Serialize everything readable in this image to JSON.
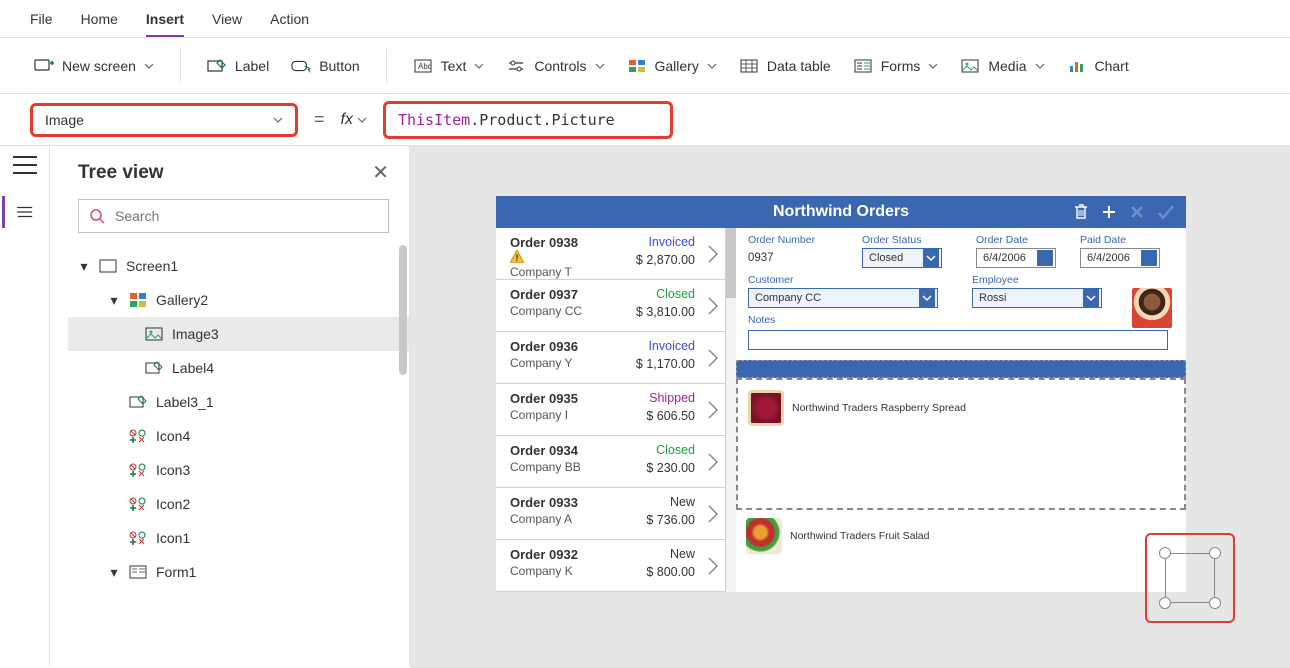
{
  "menu": {
    "file": "File",
    "home": "Home",
    "insert": "Insert",
    "view": "View",
    "action": "Action"
  },
  "ribbon": {
    "new_screen": "New screen",
    "label": "Label",
    "button": "Button",
    "text": "Text",
    "controls": "Controls",
    "gallery": "Gallery",
    "data_table": "Data table",
    "forms": "Forms",
    "media": "Media",
    "chart": "Chart"
  },
  "formula": {
    "property": "Image",
    "fx": "fx",
    "token_thisitem": "ThisItem",
    "token_rest": ".Product.Picture"
  },
  "tree": {
    "title": "Tree view",
    "search_placeholder": "Search",
    "nodes": {
      "screen1": "Screen1",
      "gallery2": "Gallery2",
      "image3": "Image3",
      "label4": "Label4",
      "label3_1": "Label3_1",
      "icon4": "Icon4",
      "icon3": "Icon3",
      "icon2": "Icon2",
      "icon1": "Icon1",
      "form1": "Form1"
    }
  },
  "app": {
    "title": "Northwind Orders",
    "orders": [
      {
        "num": "Order 0938",
        "company": "Company T",
        "status": "Invoiced",
        "status_cls": "st-invoiced",
        "amount": "$ 2,870.00",
        "warn": true
      },
      {
        "num": "Order 0937",
        "company": "Company CC",
        "status": "Closed",
        "status_cls": "st-closed",
        "amount": "$ 3,810.00",
        "warn": false
      },
      {
        "num": "Order 0936",
        "company": "Company Y",
        "status": "Invoiced",
        "status_cls": "st-invoiced",
        "amount": "$ 1,170.00",
        "warn": false
      },
      {
        "num": "Order 0935",
        "company": "Company I",
        "status": "Shipped",
        "status_cls": "st-shipped",
        "amount": "$ 606.50",
        "warn": false
      },
      {
        "num": "Order 0934",
        "company": "Company BB",
        "status": "Closed",
        "status_cls": "st-closed",
        "amount": "$ 230.00",
        "warn": false
      },
      {
        "num": "Order 0933",
        "company": "Company A",
        "status": "New",
        "status_cls": "st-new",
        "amount": "$ 736.00",
        "warn": false
      },
      {
        "num": "Order 0932",
        "company": "Company K",
        "status": "New",
        "status_cls": "st-new",
        "amount": "$ 800.00",
        "warn": false
      }
    ],
    "detail": {
      "labels": {
        "order_number": "Order Number",
        "order_status": "Order Status",
        "order_date": "Order Date",
        "paid_date": "Paid Date",
        "customer": "Customer",
        "employee": "Employee",
        "notes": "Notes"
      },
      "order_number": "0937",
      "order_status": "Closed",
      "order_date": "6/4/2006",
      "paid_date": "6/4/2006",
      "customer": "Company CC",
      "employee": "Rossi"
    },
    "gallery": {
      "item1": "Northwind Traders Raspberry Spread",
      "item2": "Northwind Traders Fruit Salad"
    }
  }
}
